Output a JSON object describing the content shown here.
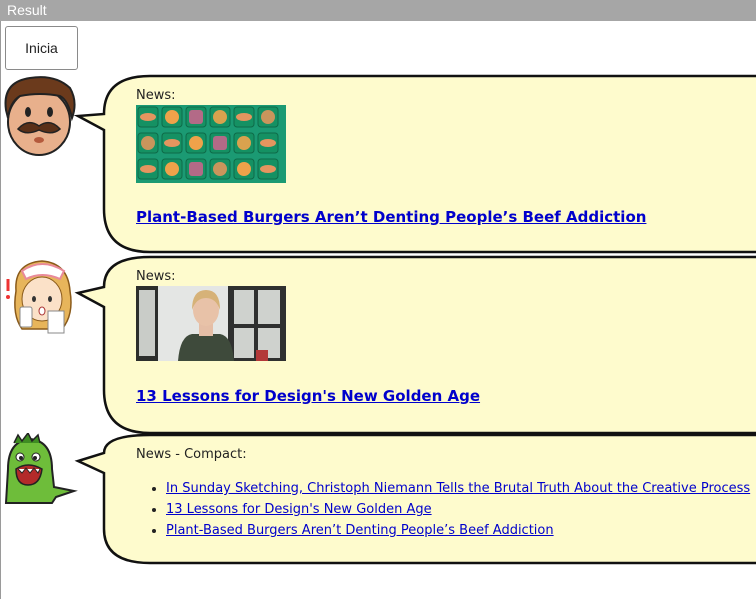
{
  "frame": {
    "title": "Result"
  },
  "toolbar": {
    "start_label": "Inicia"
  },
  "messages": [
    {
      "label": "News:",
      "title": "Plant-Based Burgers Aren’t Denting People’s Beef Addiction"
    },
    {
      "label": "News:",
      "title": "13 Lessons for Design's New Golden Age"
    },
    {
      "label": "News - Compact:",
      "items": [
        "In Sunday Sketching, Christoph Niemann Tells the Brutal Truth About the Creative Process",
        "13 Lessons for Design's New Golden Age",
        "Plant-Based Burgers Aren’t Denting People’s Beef Addiction"
      ]
    }
  ],
  "colors": {
    "bubble_fill": "#fefbcd",
    "link": "#0000cc",
    "bar": "#a6a6a6"
  }
}
